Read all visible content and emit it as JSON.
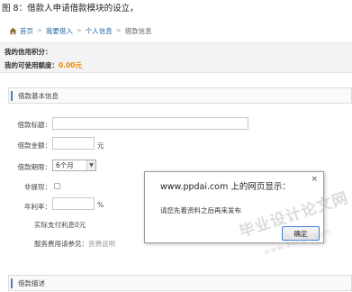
{
  "caption": "图 8：借款人申请借款模块的设立，",
  "breadcrumb": {
    "items": [
      "首页",
      "我要借入",
      "个人信息",
      "借款信息"
    ],
    "separator": ">"
  },
  "credit": {
    "score_label": "我的信用积分：",
    "quota_label": "我的可使用额度：",
    "quota_value": "0.00元"
  },
  "section_basic": {
    "title": "借款基本信息"
  },
  "form": {
    "title_label": "借款标题：",
    "title_value": "",
    "amount_label": "借款金额：",
    "amount_value": "",
    "amount_unit": "元",
    "period_label": "借款期限：",
    "period_selected": "6个月",
    "discount_label": "非提现：",
    "rate_label": "年利率：",
    "rate_value": "",
    "rate_unit": "%",
    "actual_interest": "实际支付利息0元",
    "fee_label": "服务费用请参见：",
    "fee_link": "资费说明"
  },
  "section_desc": {
    "title": "借款描述"
  },
  "dialog": {
    "title": "www.ppdai.com 上的网页显示：",
    "message": "请您先着资料之后再来发布",
    "ok_label": "确定",
    "close_glyph": "×"
  },
  "watermark": {
    "text": "毕业设计论文网",
    "url": "www.56doc.com"
  },
  "colors": {
    "link": "#2a6ca8",
    "accent_bar": "#4a7fc1",
    "amount": "#f08a00"
  }
}
